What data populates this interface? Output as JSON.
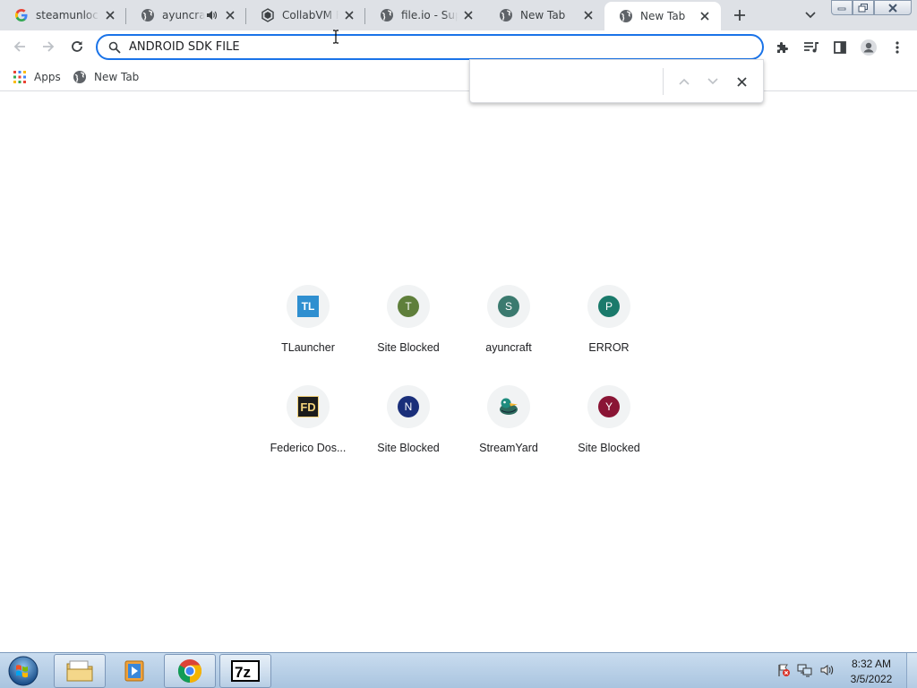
{
  "tabs": [
    {
      "title": "steamunlocked",
      "favicon": "google-g-icon"
    },
    {
      "title": "ayuncraft",
      "favicon": "globe-icon",
      "audio": "speaker-icon"
    },
    {
      "title": "CollabVM Rooms",
      "favicon": "collabvm-icon"
    },
    {
      "title": "file.io - Super simple file sharing",
      "favicon": "globe-icon"
    },
    {
      "title": "New Tab",
      "favicon": "globe-icon"
    },
    {
      "title": "New Tab",
      "favicon": "globe-icon",
      "active": true
    }
  ],
  "omnibox": {
    "value": "ANDROID SDK FILE"
  },
  "findbar": {
    "value": ""
  },
  "bookmarks": [
    {
      "label": "Apps",
      "icon": "apps-grid-icon"
    },
    {
      "label": "New Tab",
      "icon": "globe-icon"
    }
  ],
  "shortcuts": [
    {
      "label": "TLauncher",
      "glyph": "TL",
      "color": "#2f8fd0"
    },
    {
      "label": "Site Blocked",
      "glyph": "T",
      "color": "#5f7f3b"
    },
    {
      "label": "ayuncraft",
      "glyph": "S",
      "color": "#3b7a6f"
    },
    {
      "label": "ERROR",
      "glyph": "P",
      "color": "#1a7a6b"
    },
    {
      "label": "Federico Dos...",
      "glyph": "FD",
      "color": "#1c1c1c"
    },
    {
      "label": "Site Blocked",
      "glyph": "N",
      "color": "#1a2f7a"
    },
    {
      "label": "StreamYard",
      "glyph": "",
      "color": "#2aa8a0"
    },
    {
      "label": "Site Blocked",
      "glyph": "Y",
      "color": "#8a1535"
    }
  ],
  "taskbar": {
    "apps": [
      "explorer-folder-icon",
      "media-player-icon",
      "chrome-icon",
      "7zip-icon"
    ],
    "tray_icons": [
      "action-center-flag-icon",
      "network-icon",
      "volume-icon"
    ],
    "time": "8:32 AM",
    "date": "3/5/2022"
  }
}
